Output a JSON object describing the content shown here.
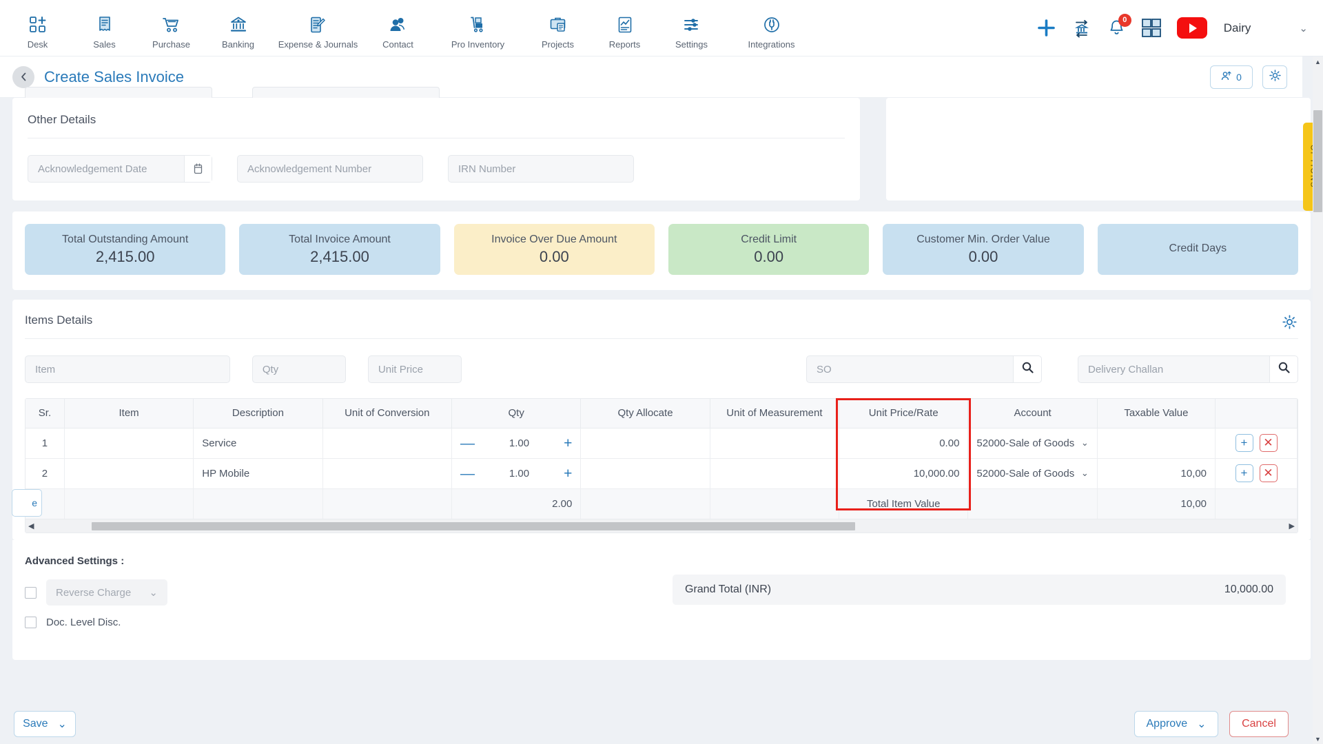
{
  "nav": {
    "items": [
      {
        "label": "Desk",
        "icon": "desk-icon"
      },
      {
        "label": "Sales",
        "icon": "sales-icon"
      },
      {
        "label": "Purchase",
        "icon": "purchase-icon"
      },
      {
        "label": "Banking",
        "icon": "banking-icon"
      },
      {
        "label": "Expense & Journals",
        "icon": "expense-journals-icon"
      },
      {
        "label": "Contact",
        "icon": "contact-icon"
      },
      {
        "label": "Pro Inventory",
        "icon": "pro-inventory-icon"
      },
      {
        "label": "Projects",
        "icon": "projects-icon"
      },
      {
        "label": "Reports",
        "icon": "reports-icon"
      },
      {
        "label": "Settings",
        "icon": "settings-icon"
      },
      {
        "label": "Integrations",
        "icon": "integrations-icon"
      }
    ],
    "right": {
      "add_icon": "plus-icon",
      "bank_icon": "bank-transfer-icon",
      "notification_icon": "bell-icon",
      "notification_count": "0",
      "apps_icon": "apps-grid-icon",
      "youtube_icon": "youtube-icon",
      "user_name": "Dairy",
      "user_caret": "⌄"
    }
  },
  "header": {
    "back_icon": "chevron-left-icon",
    "title": "Create Sales Invoice",
    "user_count": "0",
    "user_icon": "user-upload-icon",
    "gear_icon": "gear-icon"
  },
  "options_tab": {
    "label": "OPTIONS"
  },
  "other_details": {
    "title": "Other Details",
    "acknowledgement_date_placeholder": "Acknowledgement Date",
    "calendar_icon": "calendar-icon",
    "acknowledgement_number_placeholder": "Acknowledgement Number",
    "irn_number_placeholder": "IRN Number"
  },
  "summary_cards": [
    {
      "label": "Total Outstanding Amount",
      "value": "2,415.00",
      "color": "#c8e0f0"
    },
    {
      "label": "Total Invoice Amount",
      "value": "2,415.00",
      "color": "#c8e0f0"
    },
    {
      "label": "Invoice Over Due Amount",
      "value": "0.00",
      "color": "#fbeec8"
    },
    {
      "label": "Credit Limit",
      "value": "0.00",
      "color": "#c9e8c6"
    },
    {
      "label": "Customer Min. Order Value",
      "value": "0.00",
      "color": "#c8e0f0"
    },
    {
      "label": "Credit Days",
      "value": "",
      "color": "#c8e0f0"
    }
  ],
  "items_details": {
    "title": "Items Details",
    "gear_icon": "gear-icon",
    "filters": {
      "item_placeholder": "Item",
      "qty_placeholder": "Qty",
      "unit_price_placeholder": "Unit Price",
      "so_placeholder": "SO",
      "so_search_icon": "search-icon",
      "delivery_challan_placeholder": "Delivery Challan",
      "dc_search_icon": "search-icon"
    },
    "columns": [
      "Sr.",
      "Item",
      "Description",
      "Unit of Conversion",
      "Qty",
      "Qty Allocate",
      "Unit of Measurement",
      "Unit Price/Rate",
      "Account",
      "Taxable Value"
    ],
    "highlighted_column": "Unit Price/Rate",
    "highlight_color": "#e8201a",
    "rows": [
      {
        "sr": "1",
        "item": "",
        "description": "Service",
        "unit_of_conversion": "",
        "qty_minus": "—",
        "qty": "1.00",
        "qty_plus": "+",
        "qty_allocate": "",
        "unit_of_measurement": "",
        "unit_price": "0.00",
        "account": "52000-Sale of Goods",
        "account_chevron": "⌄",
        "taxable_value": "",
        "add_icon": "add-row-icon",
        "delete_icon": "delete-row-icon"
      },
      {
        "sr": "2",
        "item": "",
        "description": "HP Mobile",
        "unit_of_conversion": "",
        "qty_minus": "—",
        "qty": "1.00",
        "qty_plus": "+",
        "qty_allocate": "",
        "unit_of_measurement": "",
        "unit_price": "10,000.00",
        "account": "52000-Sale of Goods",
        "account_chevron": "⌄",
        "taxable_value": "10,00",
        "add_icon": "add-row-icon",
        "delete_icon": "delete-row-icon"
      }
    ],
    "total_row": {
      "select_chip": "e",
      "qty_total": "2.00",
      "total_item_value_label": "Total Item Value",
      "total_item_value": "10,00"
    },
    "hscroll": {
      "left_arrow": "◀",
      "right_arrow": "▶"
    }
  },
  "advanced": {
    "title": "Advanced Settings :",
    "reverse_charge_label": "Reverse Charge",
    "reverse_charge_chevron": "⌄",
    "doc_level_disc_label": "Doc. Level Disc.",
    "grand_total_label": "Grand Total (INR)",
    "grand_total_value": "10,000.00"
  },
  "footer": {
    "save_label": "Save",
    "save_chevron": "⌄",
    "approve_label": "Approve",
    "approve_chevron": "⌄",
    "cancel_label": "Cancel"
  },
  "scroll": {
    "up_arrow": "▲",
    "down_arrow": "▼"
  }
}
